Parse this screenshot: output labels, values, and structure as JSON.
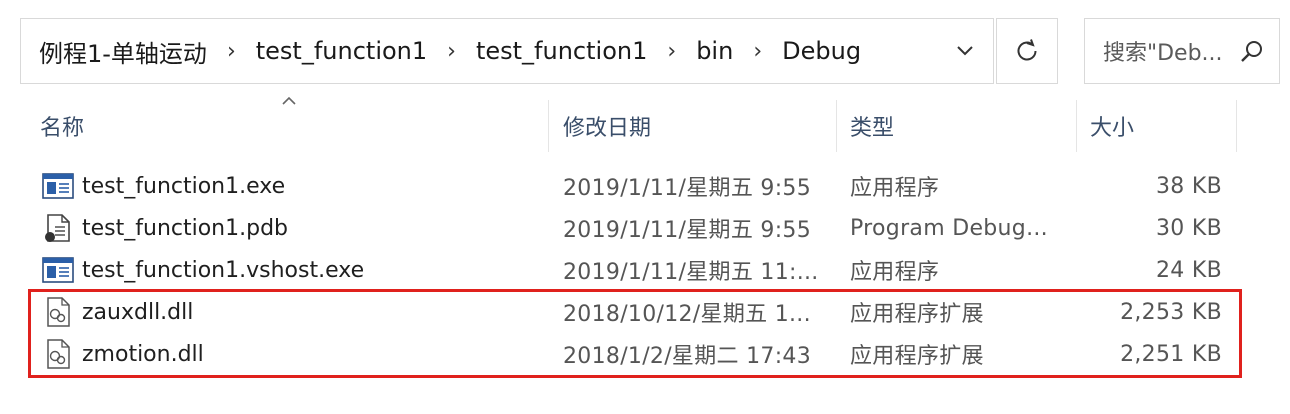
{
  "breadcrumb": [
    "例程1-单轴运动",
    "test_function1",
    "test_function1",
    "bin",
    "Debug"
  ],
  "search": {
    "placeholder": "搜索\"Deb..."
  },
  "columns": {
    "name": "名称",
    "date": "修改日期",
    "type": "类型",
    "size": "大小"
  },
  "files": [
    {
      "name": "test_function1.exe",
      "date": "2019/1/11/星期五 9:55",
      "type": "应用程序",
      "size": "38 KB",
      "icon": "exe-icon"
    },
    {
      "name": "test_function1.pdb",
      "date": "2019/1/11/星期五 9:55",
      "type": "Program Debug...",
      "size": "30 KB",
      "icon": "pdb-icon"
    },
    {
      "name": "test_function1.vshost.exe",
      "date": "2019/1/11/星期五 11:...",
      "type": "应用程序",
      "size": "24 KB",
      "icon": "exe-icon"
    },
    {
      "name": "zauxdll.dll",
      "date": "2018/10/12/星期五 1...",
      "type": "应用程序扩展",
      "size": "2,253 KB",
      "icon": "dll-icon"
    },
    {
      "name": "zmotion.dll",
      "date": "2018/1/2/星期二 17:43",
      "type": "应用程序扩展",
      "size": "2,251 KB",
      "icon": "dll-icon"
    }
  ],
  "colors": {
    "highlight": "#e0211d",
    "header_text": "#3a4e6a"
  }
}
